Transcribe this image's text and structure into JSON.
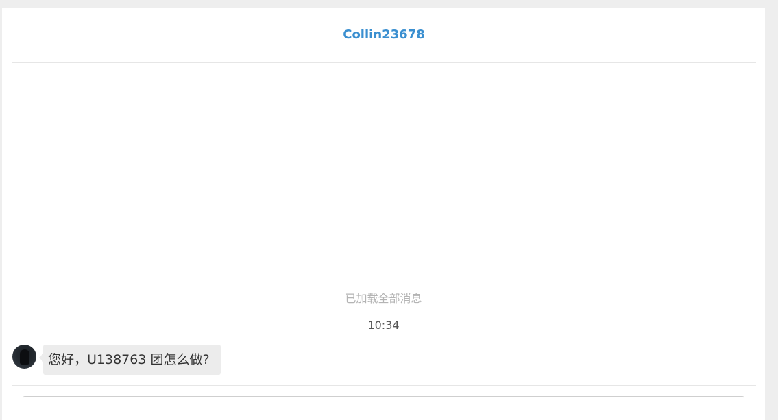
{
  "header": {
    "title": "Collin23678"
  },
  "messages": {
    "load_status": "已加载全部消息",
    "items": [
      {
        "time": "10:34",
        "avatar_icon": "user-avatar",
        "text": "您好，U138763 团怎么做?"
      }
    ]
  },
  "composer": {
    "input_value": "",
    "placeholder": ""
  },
  "colors": {
    "title": "#3a8fd0",
    "bubble": "#ececec",
    "background": "#eeeeee"
  }
}
